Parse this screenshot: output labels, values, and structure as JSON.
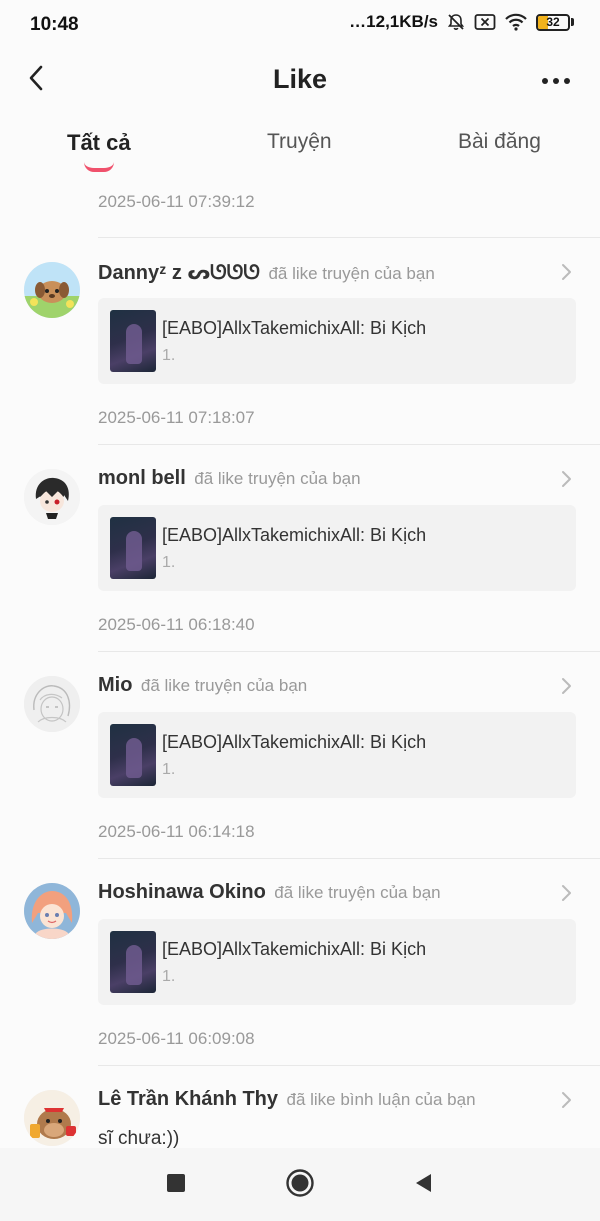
{
  "status_bar": {
    "time": "10:48",
    "network_speed": "…12,1KB/s",
    "battery_level": "32",
    "icons": [
      "mute-bell-icon",
      "sim-off-icon",
      "wifi-icon",
      "battery-icon"
    ]
  },
  "header": {
    "title": "Like",
    "back_icon": "back-arrow-icon",
    "more_icon": "more-icon"
  },
  "tabs": [
    {
      "label": "Tất cả",
      "active": true
    },
    {
      "label": "Truyện",
      "active": false
    },
    {
      "label": "Bài đăng",
      "active": false
    }
  ],
  "colors": {
    "accent": "#f0516c",
    "battery": "#f2b21b"
  },
  "list": {
    "first_timestamp": "2025-06-11 07:39:12",
    "items": [
      {
        "user": "Dannyᶻ z ᔕᘎᘎᘎ",
        "action": "đã like truyện của bạn",
        "card_title": "[EABO]AllxTakemichixAll: Bi Kịch",
        "card_sub": "1.",
        "timestamp": "2025-06-11 07:18:07"
      },
      {
        "user": "monl bell",
        "action": "đã like truyện của bạn",
        "card_title": "[EABO]AllxTakemichixAll: Bi Kịch",
        "card_sub": "1.",
        "timestamp": "2025-06-11 06:18:40"
      },
      {
        "user": "Mio",
        "action": "đã like truyện của bạn",
        "card_title": "[EABO]AllxTakemichixAll: Bi Kịch",
        "card_sub": "1.",
        "timestamp": "2025-06-11 06:14:18"
      },
      {
        "user": "Hoshinawa Okino",
        "action": "đã like truyện của bạn",
        "card_title": "[EABO]AllxTakemichixAll: Bi Kịch",
        "card_sub": "1.",
        "timestamp": "2025-06-11 06:09:08"
      },
      {
        "user": "Lê Trần Khánh Thy",
        "action": "đã like bình luận của bạn",
        "comment": "sĩ chưa:))"
      }
    ]
  },
  "nav_bar": {
    "icons": [
      "recents-icon",
      "home-icon",
      "back-icon"
    ]
  }
}
